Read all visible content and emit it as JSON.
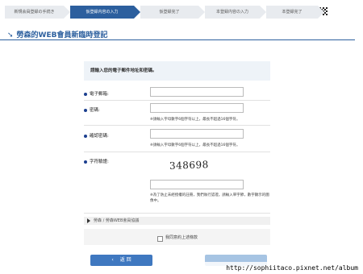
{
  "stepper": {
    "steps": [
      {
        "label": "新規会員登録の手続き",
        "active": false
      },
      {
        "label": "仮登録内容の入力",
        "active": true
      },
      {
        "label": "仮登録完了",
        "active": false
      },
      {
        "label": "本登録内容の入力",
        "active": false
      },
      {
        "label": "本登録完了",
        "active": false
      }
    ]
  },
  "page": {
    "title_arrow": "➘",
    "title": "勞森的WEB會員新臨時登記"
  },
  "form": {
    "intro": "請輸入您的電子郵件地址和密碼。",
    "email_label": "電子郵箱:",
    "email_value": "",
    "password_label": "密碼:",
    "password_value": "",
    "password_hint": "※請輸入字母數字6個字符以上，最長不超過16個字符。",
    "confirm_label": "確認密碼:",
    "confirm_value": "",
    "confirm_hint": "※請輸入字母數字6個字符以上，最長不超過16個字符。",
    "captcha_label": "字符驗證:",
    "captcha_text": "348698",
    "captcha_value": "",
    "captcha_hint": "※為了防止未經授權的註冊，我們執行認證。請輸入單字節，數字顯示的圖像中。",
    "terms_label": "勞森 / 勞森WEB會員協議",
    "agree_label": "我同意約上述條款"
  },
  "buttons": {
    "back_arrow": "‹",
    "back_label": "返 回",
    "next_label": ""
  },
  "watermark": "http://sophiitaco.pixnet.net/album"
}
